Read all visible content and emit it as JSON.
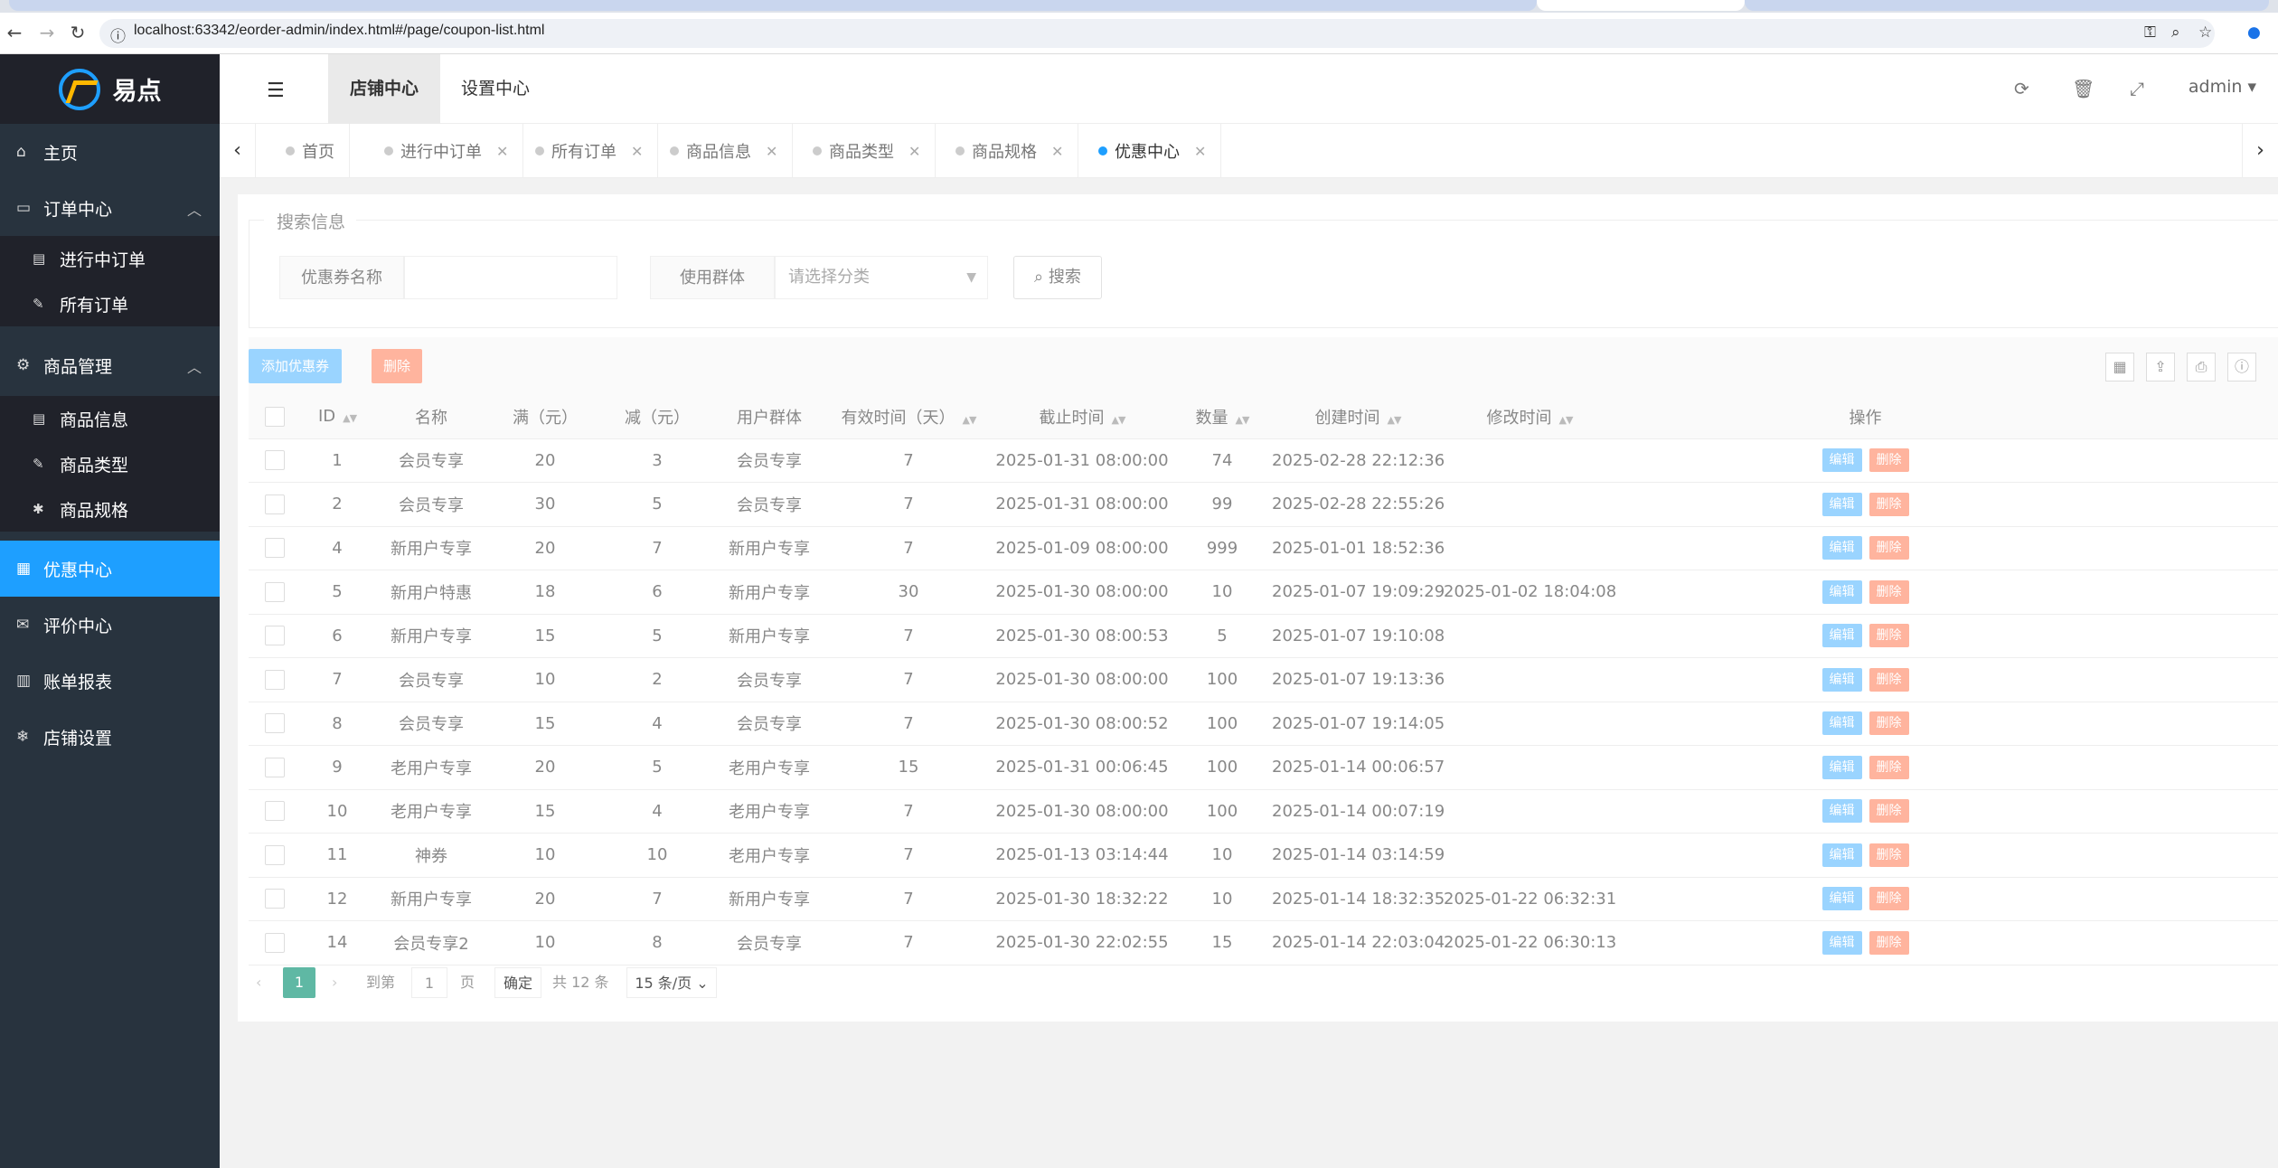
{
  "browser": {
    "url": "localhost:63342/eorder-admin/index.html#/page/coupon-list.html"
  },
  "logo": {
    "name": "易点"
  },
  "sidebar": {
    "home": "主页",
    "order_center": "订单中心",
    "orders_in_progress": "进行中订单",
    "all_orders": "所有订单",
    "product_mgmt": "商品管理",
    "product_info": "商品信息",
    "product_type": "商品类型",
    "product_spec": "商品规格",
    "coupon_center": "优惠中心",
    "review_center": "评价中心",
    "bill_report": "账单报表",
    "store_settings": "店铺设置"
  },
  "header": {
    "tab_store": "店铺中心",
    "tab_settings": "设置中心",
    "user": "admin"
  },
  "page_tabs": [
    "首页",
    "进行中订单",
    "所有订单",
    "商品信息",
    "商品类型",
    "商品规格",
    "优惠中心"
  ],
  "search": {
    "legend": "搜索信息",
    "coupon_name_label": "优惠券名称",
    "group_label": "使用群体",
    "group_placeholder": "请选择分类",
    "search_btn": "搜索"
  },
  "toolbar": {
    "add": "添加优惠券",
    "delete": "删除"
  },
  "table": {
    "headers": [
      "ID",
      "名称",
      "满（元）",
      "减（元）",
      "用户群体",
      "有效时间（天）",
      "截止时间",
      "数量",
      "创建时间",
      "修改时间",
      "操作"
    ],
    "rows": [
      [
        "1",
        "会员专享",
        "20",
        "3",
        "会员专享",
        "7",
        "2025-01-31 08:00:00",
        "74",
        "2025-02-28 22:12:36",
        ""
      ],
      [
        "2",
        "会员专享",
        "30",
        "5",
        "会员专享",
        "7",
        "2025-01-31 08:00:00",
        "99",
        "2025-02-28 22:55:26",
        ""
      ],
      [
        "4",
        "新用户专享",
        "20",
        "7",
        "新用户专享",
        "7",
        "2025-01-09 08:00:00",
        "999",
        "2025-01-01 18:52:36",
        ""
      ],
      [
        "5",
        "新用户特惠",
        "18",
        "6",
        "新用户专享",
        "30",
        "2025-01-30 08:00:00",
        "10",
        "2025-01-07 19:09:29",
        "2025-01-02 18:04:08"
      ],
      [
        "6",
        "新用户专享",
        "15",
        "5",
        "新用户专享",
        "7",
        "2025-01-30 08:00:53",
        "5",
        "2025-01-07 19:10:08",
        ""
      ],
      [
        "7",
        "会员专享",
        "10",
        "2",
        "会员专享",
        "7",
        "2025-01-30 08:00:00",
        "100",
        "2025-01-07 19:13:36",
        ""
      ],
      [
        "8",
        "会员专享",
        "15",
        "4",
        "会员专享",
        "7",
        "2025-01-30 08:00:52",
        "100",
        "2025-01-07 19:14:05",
        ""
      ],
      [
        "9",
        "老用户专享",
        "20",
        "5",
        "老用户专享",
        "15",
        "2025-01-31 00:06:45",
        "100",
        "2025-01-14 00:06:57",
        ""
      ],
      [
        "10",
        "老用户专享",
        "15",
        "4",
        "老用户专享",
        "7",
        "2025-01-30 08:00:00",
        "100",
        "2025-01-14 00:07:19",
        ""
      ],
      [
        "11",
        "神券",
        "10",
        "10",
        "老用户专享",
        "7",
        "2025-01-13 03:14:44",
        "10",
        "2025-01-14 03:14:59",
        ""
      ],
      [
        "12",
        "新用户专享",
        "20",
        "7",
        "新用户专享",
        "7",
        "2025-01-30 18:32:22",
        "10",
        "2025-01-14 18:32:35",
        "2025-01-22 06:32:31"
      ],
      [
        "14",
        "会员专享2",
        "10",
        "8",
        "会员专享",
        "7",
        "2025-01-30 22:02:55",
        "15",
        "2025-01-14 22:03:04",
        "2025-01-22 06:30:13"
      ]
    ],
    "op_edit": "编辑",
    "op_delete": "删除"
  },
  "pager": {
    "current": "1",
    "goto_label": "到第",
    "goto_value": "1",
    "page_unit": "页",
    "confirm": "确定",
    "total": "共 12 条",
    "per_page": "15 条/页"
  },
  "colors": {
    "accent": "#1e9fff",
    "sidebar": "#28333e",
    "edit_btn": "#9ad4ff",
    "delete_btn": "#ffb49e",
    "pager_current": "#5fb8a4"
  }
}
